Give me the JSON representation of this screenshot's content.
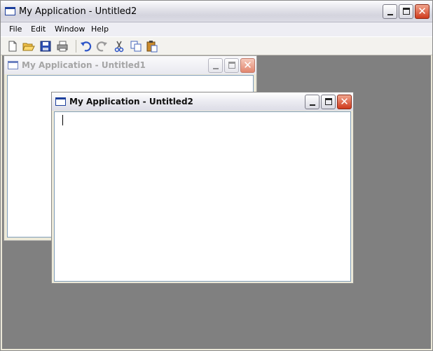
{
  "main_window": {
    "title": "My Application - Untitled2",
    "icon": "window-icon"
  },
  "menu": {
    "items": [
      "File",
      "Edit",
      "Window",
      "Help"
    ]
  },
  "toolbar": {
    "buttons": [
      "new-icon",
      "open-icon",
      "save-icon",
      "print-icon",
      "undo-icon",
      "redo-icon",
      "cut-icon",
      "copy-icon",
      "paste-icon"
    ]
  },
  "mdi": {
    "background": "#808080",
    "windows": [
      {
        "title": "My Application - Untitled1",
        "state": "inactive"
      },
      {
        "title": "My Application - Untitled2",
        "state": "active"
      }
    ]
  },
  "colors": {
    "close_button": "#cf3a1c",
    "icon_blue": "#1d3f9c"
  }
}
